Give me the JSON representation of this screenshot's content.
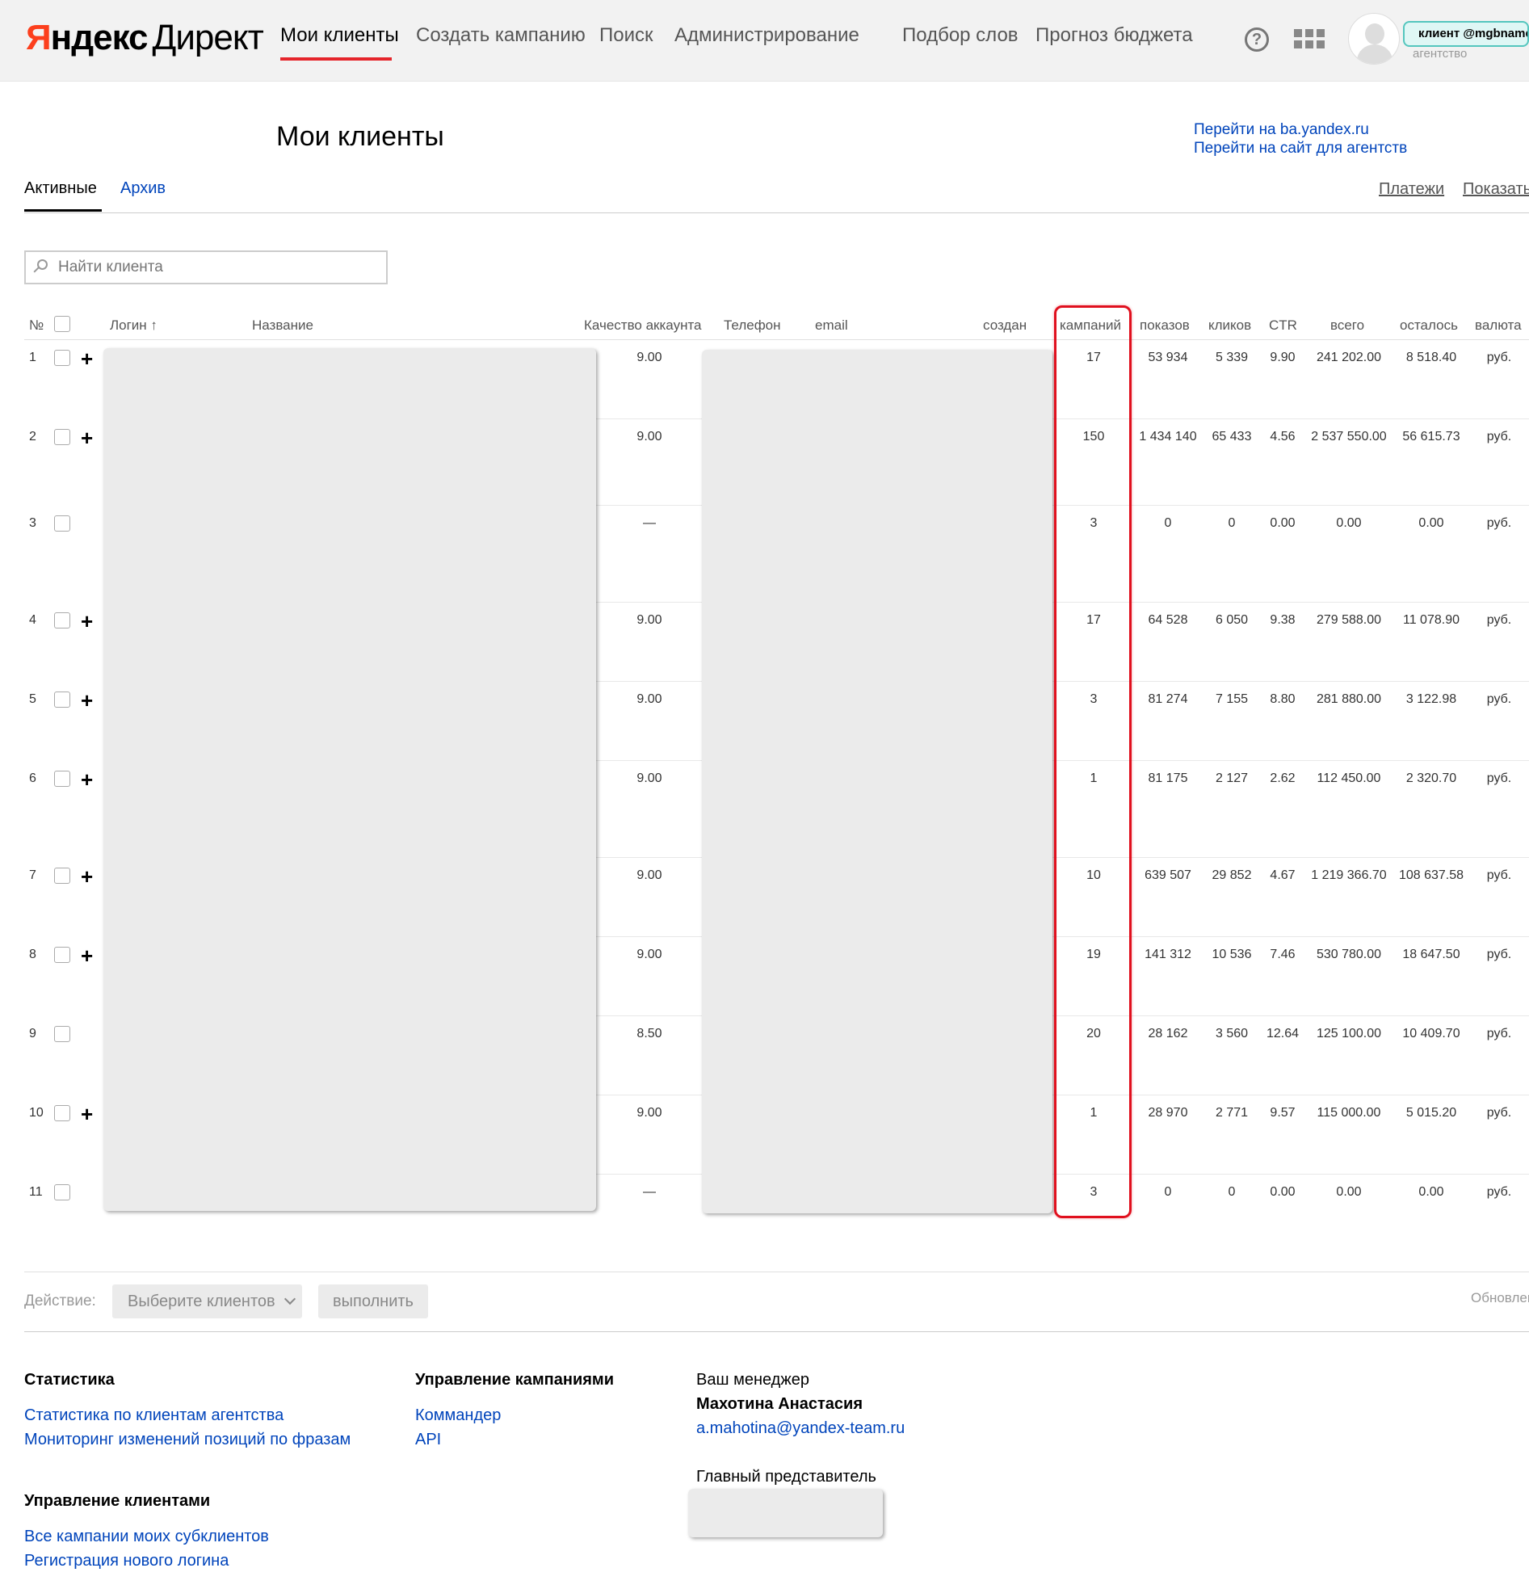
{
  "header": {
    "logo_ya": "Я",
    "logo_ndex": "ндекс",
    "logo_direct": "Директ",
    "nav": [
      {
        "label": "Мои клиенты",
        "active": true
      },
      {
        "label": "Создать кампанию",
        "active": false
      },
      {
        "label": "Поиск",
        "active": false
      },
      {
        "label": "Администрирование",
        "active": false
      },
      {
        "label": "Подбор слов",
        "active": false
      },
      {
        "label": "Прогноз бюджета",
        "active": false
      }
    ],
    "help_icon": "question-circle-icon",
    "apps_icon": "grid-apps-icon",
    "client_badge": "клиент @mgbname",
    "agency_label": "агентство"
  },
  "page": {
    "title": "Мои клиенты",
    "links": [
      "Перейти на ba.yandex.ru",
      "Перейти на сайт для агентств"
    ]
  },
  "tabs": {
    "active": "Активные",
    "archive": "Архив",
    "payments": "Платежи",
    "show": "Показать"
  },
  "search": {
    "placeholder": "Найти клиента"
  },
  "table": {
    "headers": {
      "num": "№",
      "login": "Логин ↑",
      "name": "Название",
      "quality": "Качество аккаунта",
      "phone": "Телефон",
      "email": "email",
      "created": "создан",
      "campaigns": "кампаний",
      "shows": "показов",
      "clicks": "кликов",
      "ctr": "CTR",
      "total": "всего",
      "left": "осталось",
      "currency": "валюта"
    },
    "rows": [
      {
        "num": "1",
        "plus": "+",
        "quality": "9.00",
        "campaigns": "17",
        "shows": "53 934",
        "clicks": "5 339",
        "ctr": "9.90",
        "total": "241 202.00",
        "left": "8 518.40",
        "currency": "руб."
      },
      {
        "num": "2",
        "plus": "+",
        "quality": "9.00",
        "campaigns": "150",
        "shows": "1 434 140",
        "clicks": "65 433",
        "ctr": "4.56",
        "total": "2 537 550.00",
        "left": "56 615.73",
        "currency": "руб."
      },
      {
        "num": "3",
        "plus": "",
        "quality": "—",
        "campaigns": "3",
        "shows": "0",
        "clicks": "0",
        "ctr": "0.00",
        "total": "0.00",
        "left": "0.00",
        "currency": "руб."
      },
      {
        "num": "4",
        "plus": "+",
        "quality": "9.00",
        "campaigns": "17",
        "shows": "64 528",
        "clicks": "6 050",
        "ctr": "9.38",
        "total": "279 588.00",
        "left": "11 078.90",
        "currency": "руб."
      },
      {
        "num": "5",
        "plus": "+",
        "quality": "9.00",
        "campaigns": "3",
        "shows": "81 274",
        "clicks": "7 155",
        "ctr": "8.80",
        "total": "281 880.00",
        "left": "3 122.98",
        "currency": "руб."
      },
      {
        "num": "6",
        "plus": "+",
        "quality": "9.00",
        "campaigns": "1",
        "shows": "81 175",
        "clicks": "2 127",
        "ctr": "2.62",
        "total": "112 450.00",
        "left": "2 320.70",
        "currency": "руб."
      },
      {
        "num": "7",
        "plus": "+",
        "quality": "9.00",
        "campaigns": "10",
        "shows": "639 507",
        "clicks": "29 852",
        "ctr": "4.67",
        "total": "1 219 366.70",
        "left": "108 637.58",
        "currency": "руб."
      },
      {
        "num": "8",
        "plus": "+",
        "quality": "9.00",
        "campaigns": "19",
        "shows": "141 312",
        "clicks": "10 536",
        "ctr": "7.46",
        "total": "530 780.00",
        "left": "18 647.50",
        "currency": "руб."
      },
      {
        "num": "9",
        "plus": "",
        "quality": "8.50",
        "campaigns": "20",
        "shows": "28 162",
        "clicks": "3 560",
        "ctr": "12.64",
        "total": "125 100.00",
        "left": "10 409.70",
        "currency": "руб."
      },
      {
        "num": "10",
        "plus": "+",
        "quality": "9.00",
        "campaigns": "1",
        "shows": "28 970",
        "clicks": "2 771",
        "ctr": "9.57",
        "total": "115 000.00",
        "left": "5 015.20",
        "currency": "руб."
      },
      {
        "num": "11",
        "plus": "",
        "quality": "—",
        "campaigns": "3",
        "shows": "0",
        "clicks": "0",
        "ctr": "0.00",
        "total": "0.00",
        "left": "0.00",
        "currency": "руб."
      }
    ]
  },
  "actions": {
    "label": "Действие:",
    "select": "Выберите клиентов",
    "execute": "выполнить",
    "updated": "Обновлен"
  },
  "footer": {
    "stats_title": "Статистика",
    "stats_links": [
      "Статистика по клиентам агентства",
      "Мониторинг изменений позиций по фразам"
    ],
    "campaigns_title": "Управление кампаниями",
    "campaigns_links": [
      "Коммандер",
      "API"
    ],
    "clients_title": "Управление клиентами",
    "clients_links": [
      "Все кампании моих субклиентов",
      "Регистрация нового логина"
    ],
    "manager_label": "Ваш менеджер",
    "manager_name": "Махотина Анастасия",
    "manager_email": "a.mahotina@yandex-team.ru",
    "representative_label": "Главный представитель"
  },
  "colors": {
    "accent_red": "#e5252b",
    "link_blue": "#0044bb",
    "highlight_red": "#e0101e"
  }
}
